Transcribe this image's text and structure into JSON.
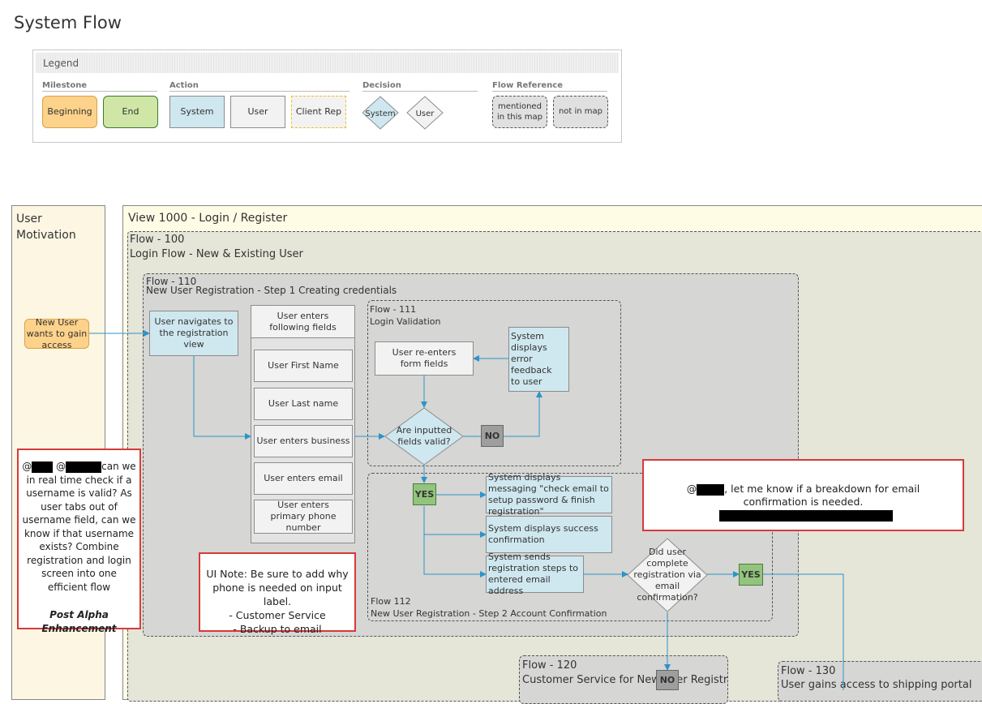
{
  "page_title": "System Flow",
  "legend": {
    "title": "Legend",
    "groups": {
      "milestone": {
        "caption": "Milestone",
        "items": [
          "Beginning",
          "End"
        ]
      },
      "action": {
        "caption": "Action",
        "items": [
          "System",
          "User",
          "Client Rep"
        ]
      },
      "decision": {
        "caption": "Decision",
        "items": [
          "System",
          "User"
        ]
      },
      "flow_reference": {
        "caption": "Flow Reference",
        "items": [
          "mentioned in this map",
          "not in map"
        ]
      }
    }
  },
  "lane": {
    "title": "User Motivation"
  },
  "view": {
    "title": "View 1000 - Login / Register"
  },
  "flow100": {
    "id": "Flow - 100",
    "title": "Login Flow - New & Existing User"
  },
  "flow110": {
    "id": "Flow - 110",
    "title": "New User Registration - Step 1 Creating credentials"
  },
  "flow111": {
    "id": "Flow - 111",
    "title": "Login Validation"
  },
  "flow112": {
    "id": "Flow 112",
    "title": "New User Registration - Step 2 Account Confirmation"
  },
  "flow120": {
    "id": "Flow - 120",
    "title": "Customer Service for New User Registration"
  },
  "flow130": {
    "id": "Flow - 130",
    "title": "User gains access to shipping portal"
  },
  "nodes": {
    "start": "New User wants to gain access",
    "navigate": "User navigates to the registration view",
    "fields_header": "User enters following fields",
    "fields": [
      "User First Name",
      "User Last name",
      "User enters business",
      "User enters email",
      "User enters primary phone number"
    ],
    "reenter": "User re-enters form fields",
    "error": "System displays error feedback to user",
    "valid_decision": "Are inputted fields valid?",
    "no1": "NO",
    "yes1": "YES",
    "msg_check_email": "System displays messaging \"check email to setup password & finish registration\"",
    "msg_success": "System displays success confirmation",
    "msg_sends": "System sends registration steps to entered email address",
    "complete_decision": "Did user complete registration via email confirmation?",
    "yes2": "YES",
    "no2": "NO"
  },
  "notes": {
    "comment_left": {
      "prefix": "@",
      "mid": " @",
      "body": "can we in real time check if a username is valid? As user tabs out of username field, can we know if that username exists?  Combine registration and login screen into one efficient flow",
      "footer": "Post Alpha Enhancement"
    },
    "ui_note": {
      "line1": "UI Note: Be sure to add why phone is needed on input label.",
      "line2": "- Customer Service",
      "line3": "- Backup to email"
    },
    "comment_right": {
      "prefix": "@",
      "body": ", let me know if a breakdown for email confirmation is needed."
    }
  },
  "colors": {
    "milestone_begin": "#fdd28a",
    "milestone_end": "#cfe6a7",
    "system": "#cfe7ef",
    "user": "#f2f2f2",
    "yes": "#93c47d",
    "no": "#9e9e9e",
    "connector": "#2b94c9",
    "note_border": "#d63a3a",
    "view_header": "#fffce6",
    "flow_region": "#e5e5d8"
  }
}
